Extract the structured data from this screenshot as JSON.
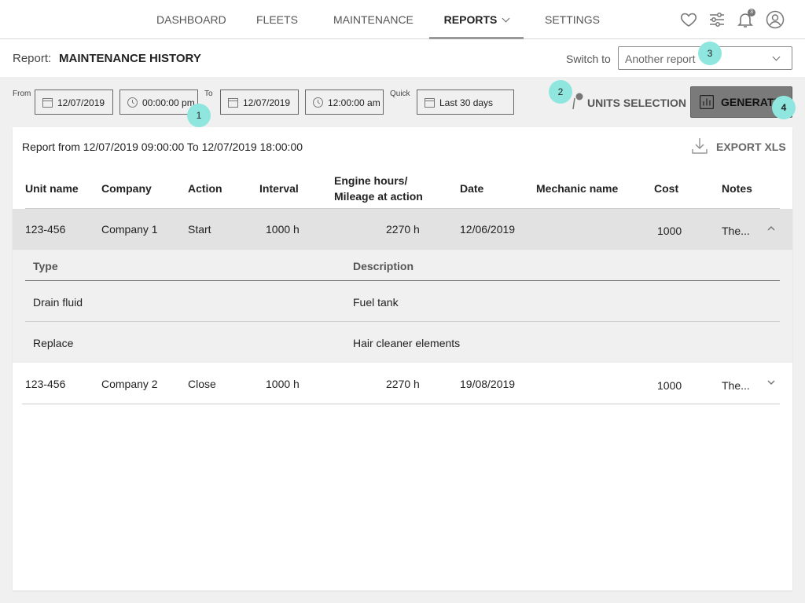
{
  "nav": {
    "tabs": [
      {
        "label": "DASHBOARD"
      },
      {
        "label": "FLEETS"
      },
      {
        "label": "MAINTENANCE"
      },
      {
        "label": "REPORTS"
      },
      {
        "label": "SETTINGS"
      }
    ],
    "active_tab": "REPORTS",
    "notification_count": "3",
    "icons": [
      "heart-icon",
      "sliders-icon",
      "bell-icon",
      "user-avatar-icon"
    ]
  },
  "report": {
    "label": "Report:",
    "title": "MAINTENANCE HISTORY",
    "switch_label": "Switch to",
    "switch_value": "Another report"
  },
  "filters": {
    "from_label": "From",
    "from_date": "12/07/2019",
    "from_time": "00:00:00 pm",
    "to_label": "To",
    "to_date": "12/07/2019",
    "to_time": "12:00:00 am",
    "quick_label": "Quick",
    "quick_value": "Last 30 days",
    "units_label": "UNITS SELECTION",
    "generate_label": "GENERATE"
  },
  "markers": [
    "1",
    "2",
    "3",
    "4"
  ],
  "summary": "Report from 12/07/2019 09:00:00 To 12/07/2019 18:00:00",
  "export_label": "EXPORT XLS",
  "columns": {
    "unit": "Unit name",
    "company": "Company",
    "action": "Action",
    "interval": "Interval",
    "engine_line1": "Engine hours/",
    "engine_line2": "Mileage at action",
    "date": "Date",
    "mechanic": "Mechanic name",
    "cost": "Cost",
    "notes": "Notes"
  },
  "rows": [
    {
      "unit": "123-456",
      "company": "Company 1",
      "action": "Start",
      "interval": "1000 h",
      "engine": "2270 h",
      "date": "12/06/2019",
      "mechanic": "",
      "cost": "1000",
      "notes": "The..."
    },
    {
      "unit": "123-456",
      "company": "Company 2",
      "action": "Close",
      "interval": "1000 h",
      "engine": "2270 h",
      "date": "19/08/2019",
      "mechanic": "",
      "cost": "1000",
      "notes": "The..."
    }
  ],
  "detail": {
    "type_header": "Type",
    "desc_header": "Description",
    "items": [
      {
        "type": "Drain fluid",
        "description": "Fuel tank"
      },
      {
        "type": "Replace",
        "description": "Hair cleaner elements"
      }
    ]
  },
  "colors": {
    "accent_marker": "#8ee6de",
    "generate_bg": "#7a7a7a",
    "expanded_row": "#e2e2e2"
  }
}
